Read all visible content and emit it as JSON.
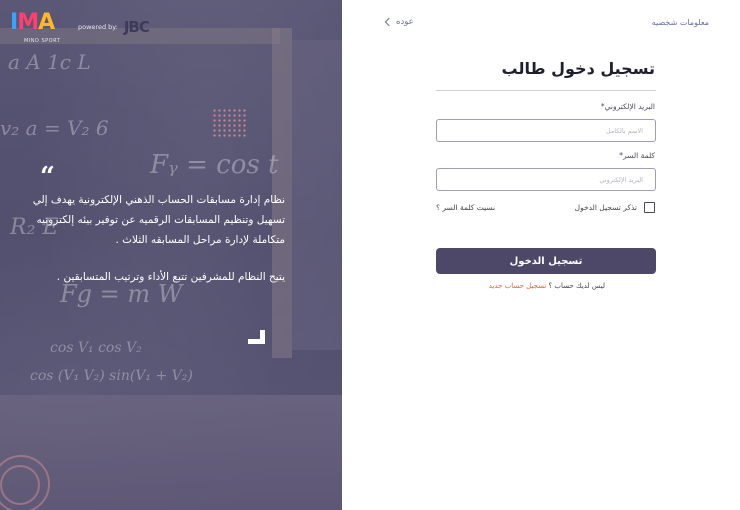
{
  "brand": {
    "logo_text": "MIND SPORT",
    "logo_letters": [
      "I",
      "M",
      "A"
    ],
    "powered_by": "powered by:",
    "partner_logo": "JBC",
    "colors": {
      "blue": "#3aa3ff",
      "pink": "#ff3f6e",
      "yellow": "#ffb627",
      "hero": "#524f6f",
      "button": "#4d4868",
      "link_orange": "#e3683a"
    }
  },
  "hero": {
    "paragraph_1": "نظام إدارة مسابقات الحساب الذهني الإلكترونية يهدف إلي تسهيل وتنظيم المسابقات الرقميه عن توفير بيئه إلكترونيه متكاملة لإدارة مراحل المسابقه الثلاث .",
    "paragraph_2": "يتيح النظام للمشرفين تتبع الأداء وترتيب المتسابقين ."
  },
  "nav": {
    "personal_info": "معلومات شخصيه",
    "back": "عوده"
  },
  "form": {
    "title": "تسجيل دخول طالب",
    "email_label": "البريد الإلكتروني*",
    "email_placeholder": "الاسم بالكامل",
    "password_label": "كلمة السر*",
    "password_placeholder": "البريد الإلكتروني",
    "remember_me": "تذكر تسجيل الدخول",
    "forgot_password": "نسيت كلمة السر ؟",
    "submit": "تسجيل الدخول",
    "no_account": "ليس لديك حساب ؟",
    "register_link": "تسجيل حساب جديد"
  }
}
